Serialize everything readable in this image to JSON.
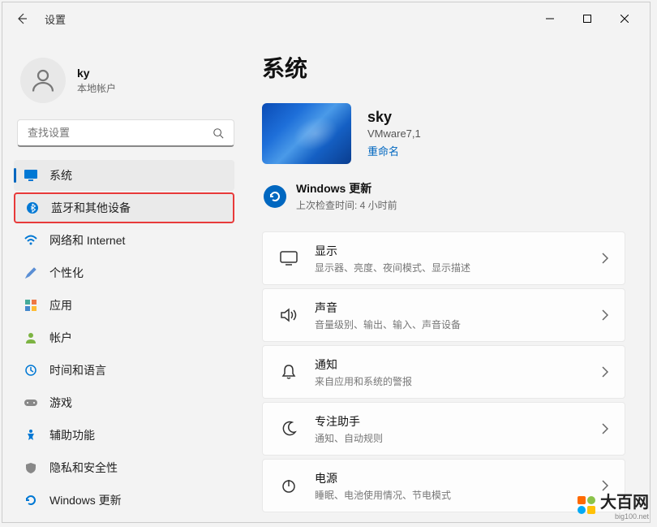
{
  "window": {
    "title": "设置"
  },
  "user": {
    "name": "ky",
    "accountType": "本地帐户"
  },
  "search": {
    "placeholder": "查找设置"
  },
  "nav": {
    "items": [
      {
        "label": "系统",
        "icon": "system"
      },
      {
        "label": "蓝牙和其他设备",
        "icon": "bluetooth"
      },
      {
        "label": "网络和 Internet",
        "icon": "network"
      },
      {
        "label": "个性化",
        "icon": "personalize"
      },
      {
        "label": "应用",
        "icon": "apps"
      },
      {
        "label": "帐户",
        "icon": "accounts"
      },
      {
        "label": "时间和语言",
        "icon": "time"
      },
      {
        "label": "游戏",
        "icon": "gaming"
      },
      {
        "label": "辅助功能",
        "icon": "accessibility"
      },
      {
        "label": "隐私和安全性",
        "icon": "privacy"
      },
      {
        "label": "Windows 更新",
        "icon": "update"
      }
    ]
  },
  "main": {
    "title": "系统",
    "device": {
      "name": "sky",
      "model": "VMware7,1",
      "renameLabel": "重命名"
    },
    "update": {
      "title": "Windows 更新",
      "sub": "上次检查时间: 4 小时前"
    },
    "settings": [
      {
        "title": "显示",
        "sub": "显示器、亮度、夜间模式、显示描述",
        "icon": "display"
      },
      {
        "title": "声音",
        "sub": "音量级别、输出、输入、声音设备",
        "icon": "sound"
      },
      {
        "title": "通知",
        "sub": "来自应用和系统的警报",
        "icon": "notifications"
      },
      {
        "title": "专注助手",
        "sub": "通知、自动规则",
        "icon": "focus"
      },
      {
        "title": "电源",
        "sub": "睡眠、电池使用情况、节电模式",
        "icon": "power"
      }
    ]
  },
  "watermark": {
    "text": "大百网",
    "sub": "big100.net"
  }
}
